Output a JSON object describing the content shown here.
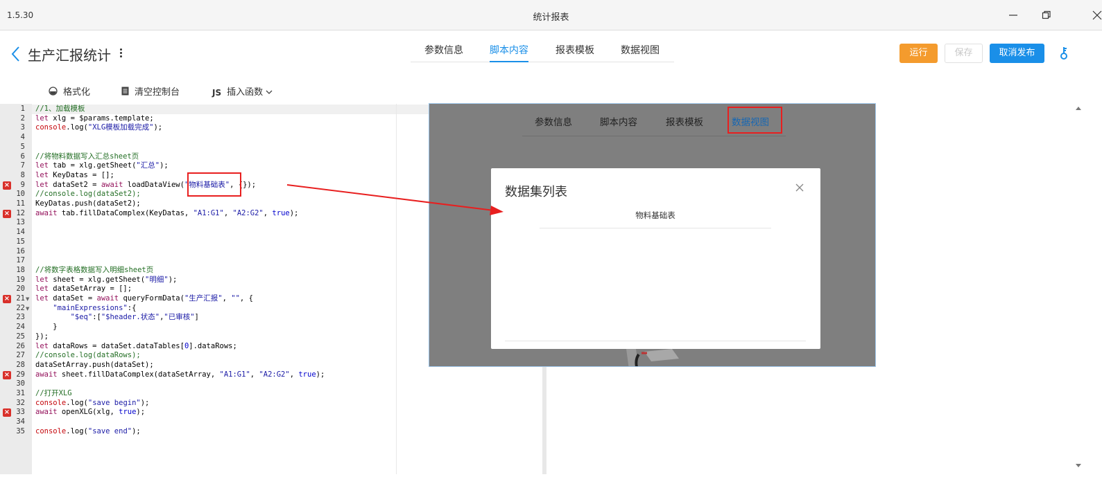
{
  "window": {
    "version": "1.5.30",
    "title": "统计报表"
  },
  "header": {
    "page_title": "生产汇报统计",
    "tabs": [
      {
        "label": "参数信息",
        "active": false
      },
      {
        "label": "脚本内容",
        "active": true
      },
      {
        "label": "报表模板",
        "active": false
      },
      {
        "label": "数据视图",
        "active": false
      }
    ],
    "buttons": {
      "run": "运行",
      "save": "保存",
      "unpublish": "取消发布"
    },
    "colors": {
      "accent": "#1a8fe8",
      "run": "#f49b2d",
      "error": "#d9302a",
      "annotation": "#e81f1f"
    }
  },
  "toolbar": {
    "format": "格式化",
    "clear_console": "清空控制台",
    "js_badge": "JS",
    "insert_function": "插入函数"
  },
  "editor": {
    "line_numbers": [
      "1",
      "2",
      "3",
      "4",
      "5",
      "6",
      "7",
      "8",
      "9",
      "10",
      "11",
      "12",
      "13",
      "14",
      "15",
      "16",
      "17",
      "18",
      "19",
      "20",
      "21",
      "22",
      "23",
      "24",
      "25",
      "26",
      "27",
      "28",
      "29",
      "30",
      "31",
      "32",
      "33",
      "34",
      "35"
    ],
    "error_lines": [
      9,
      12,
      21,
      29,
      33
    ],
    "fold_lines": [
      21,
      22
    ],
    "lines": {
      "l1": "//1、加载模板",
      "l2a": "let",
      "l2b": " xlg = $params.template;",
      "l3a": "console",
      "l3b": ".log(",
      "l3c": "\"XLG模板加载完成\"",
      "l3d": ");",
      "l6": "//将物料数据写入汇总sheet页",
      "l7a": "let",
      "l7b": " tab = xlg.getSheet(",
      "l7c": "\"汇总\"",
      "l7d": ");",
      "l8a": "let",
      "l8b": " KeyDatas = [];",
      "l9a": "let",
      "l9b": " dataSet2 = ",
      "l9c": "await",
      "l9d": " loadDataView(",
      "l9e": "\"物料基础表\"",
      "l9f": ", {});",
      "l10": "//console.log(dataSet2);",
      "l11": "KeyDatas.push(dataSet2);",
      "l12a": "await",
      "l12b": " tab.fillDataComplex(KeyDatas, ",
      "l12c": "\"A1:G1\"",
      "l12d": ", ",
      "l12e": "\"A2:G2\"",
      "l12f": ", ",
      "l12g": "true",
      "l12h": ");",
      "l18": "//将数字表格数据写入明细sheet页",
      "l19a": "let",
      "l19b": " sheet = xlg.getSheet(",
      "l19c": "\"明细\"",
      "l19d": ");",
      "l20a": "let",
      "l20b": " dataSetArray = [];",
      "l21a": "let",
      "l21b": " dataSet = ",
      "l21c": "await",
      "l21d": " queryFormData(",
      "l21e": "\"生产汇报\"",
      "l21f": ", ",
      "l21g": "\"\"",
      "l21h": ", {",
      "l22a": "    ",
      "l22b": "\"mainExpressions\"",
      "l22c": ":{",
      "l23a": "        ",
      "l23b": "\"$eq\"",
      "l23c": ":[",
      "l23d": "\"$header.状态\"",
      "l23e": ",",
      "l23f": "\"已审核\"",
      "l23g": "]",
      "l24": "    }",
      "l25": "});",
      "l26a": "let",
      "l26b": " dataRows = dataSet.dataTables[",
      "l26c": "0",
      "l26d": "].dataRows;",
      "l27": "//console.log(dataRows);",
      "l28": "dataSetArray.push(dataSet);",
      "l29a": "await",
      "l29b": " sheet.fillDataComplex(dataSetArray, ",
      "l29c": "\"A1:G1\"",
      "l29d": ", ",
      "l29e": "\"A2:G2\"",
      "l29f": ", ",
      "l29g": "true",
      "l29h": ");",
      "l31": "//打开XLG",
      "l32a": "console",
      "l32b": ".log(",
      "l32c": "\"save begin\"",
      "l32d": ");",
      "l33a": "await",
      "l33b": " openXLG(xlg, ",
      "l33c": "true",
      "l33d": ");",
      "l35a": "console",
      "l35b": ".log(",
      "l35c": "\"save end\"",
      "l35d": ");"
    }
  },
  "overlay": {
    "tabs": [
      "参数信息",
      "脚本内容",
      "报表模板",
      "数据视图"
    ],
    "dialog": {
      "title": "数据集列表",
      "items": [
        "物料基础表"
      ]
    }
  }
}
